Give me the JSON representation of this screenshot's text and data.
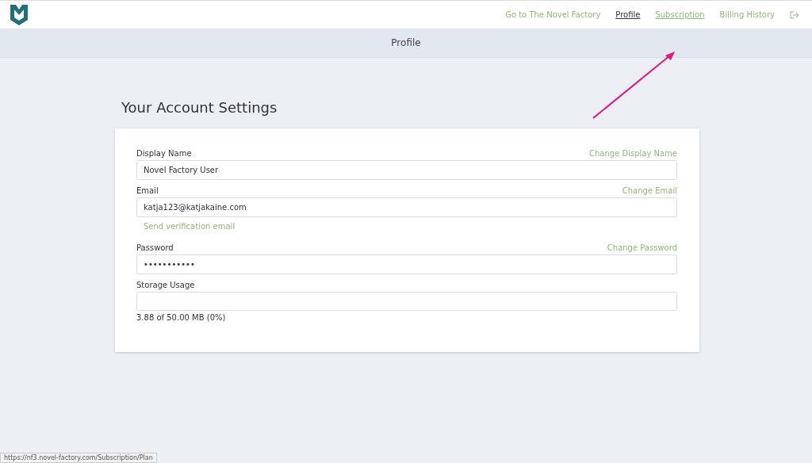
{
  "nav": {
    "links": [
      {
        "label": "Go to The Novel Factory",
        "selected": false,
        "hovered": false
      },
      {
        "label": "Profile",
        "selected": true,
        "hovered": false
      },
      {
        "label": "Subscription",
        "selected": false,
        "hovered": true
      },
      {
        "label": "Billing History",
        "selected": false,
        "hovered": false
      }
    ]
  },
  "page_title": "Profile",
  "heading": "Your Account Settings",
  "fields": [
    {
      "kind": "input",
      "label": "Display Name",
      "action": "Change Display Name",
      "value": "Novel Factory User"
    },
    {
      "kind": "input",
      "label": "Email",
      "action": "Change Email",
      "value": "katja123@katjakaine.com",
      "link": "Send verification email"
    },
    {
      "kind": "input",
      "label": "Password",
      "action": "Change Password",
      "value": "•••••••••••"
    },
    {
      "kind": "meter",
      "label": "Storage Usage",
      "level": 0,
      "reading": "3.88 of 50.00 MB (0%)"
    }
  ],
  "status_url": "https://nf3.novel-factory.com/Subscription/Plan"
}
